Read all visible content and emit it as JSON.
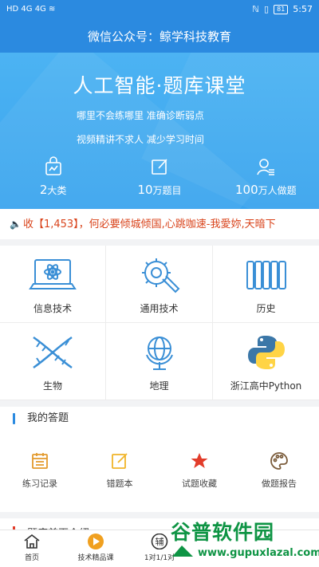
{
  "status": {
    "left": "HD 4G 4G ≋",
    "battery": "81",
    "time": "5:57"
  },
  "topbar": {
    "title": "微信公众号：鲸学科技教育"
  },
  "hero": {
    "title": "人工智能·题库课堂",
    "line1": "哪里不会练哪里  准确诊断弱点",
    "line2": "视频精讲不求人  减少学习时间",
    "stats": [
      {
        "num": "2",
        "unit": "大类",
        "icon": "bag-icon"
      },
      {
        "num": "10",
        "unit": "万题目",
        "icon": "edit-icon"
      },
      {
        "num": "100",
        "unit": "万人做题",
        "icon": "user-list-icon"
      }
    ]
  },
  "marquee": {
    "text": "收【1,453】，何必要倾城倾国,心跳咖速-我愛妳,天暗下"
  },
  "subjects": [
    {
      "label": "信息技术",
      "icon": "laptop-atom-icon"
    },
    {
      "label": "通用技术",
      "icon": "wrench-gear-icon"
    },
    {
      "label": "历史",
      "icon": "scroll-icon"
    },
    {
      "label": "生物",
      "icon": "dna-icon"
    },
    {
      "label": "地理",
      "icon": "globe-icon"
    },
    {
      "label": "浙江高中Python",
      "icon": "python-logo-icon"
    }
  ],
  "my_answers": {
    "title": "我的答题",
    "items": [
      {
        "label": "练习记录",
        "icon": "calendar-icon",
        "color": "#e39a2d"
      },
      {
        "label": "错题本",
        "icon": "edit-note-icon",
        "color": "#f0b429"
      },
      {
        "label": "试题收藏",
        "icon": "star-icon",
        "color": "#e23c2a"
      },
      {
        "label": "做题报告",
        "icon": "palette-icon",
        "color": "#7a5b3a"
      }
    ]
  },
  "next_section": {
    "title": "题库首页介绍"
  },
  "tabs": [
    {
      "label": "首页",
      "icon": "home-icon"
    },
    {
      "label": "技术精品课",
      "icon": "play-icon"
    },
    {
      "label": "1对1/1对",
      "icon": "tutor-icon",
      "glyph": "辅"
    },
    {
      "label": "",
      "icon": "tab4-icon"
    },
    {
      "label": "",
      "icon": "tab5-icon"
    }
  ],
  "watermark": {
    "title": "谷普软件园",
    "url": "www.gupuxlazal.com"
  },
  "colors": {
    "primary": "#2b8ae0",
    "hero": "#3aa4ee",
    "marquee": "#d9441c",
    "icon": "#3a8fd6"
  }
}
